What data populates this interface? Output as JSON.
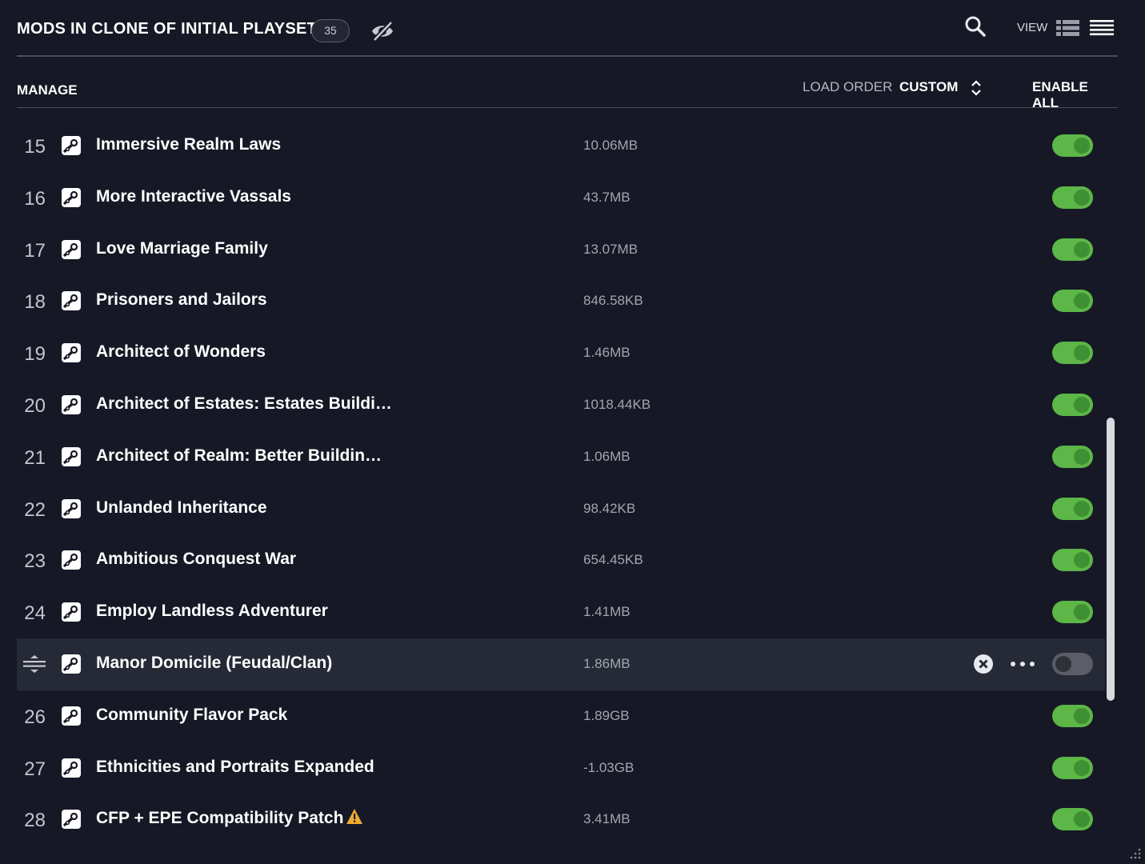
{
  "header": {
    "title": "MODS IN CLONE OF INITIAL PLAYSET",
    "count": "35",
    "view_label": "VIEW"
  },
  "subheader": {
    "manage": "MANAGE",
    "load_order_label": "LOAD ORDER",
    "load_order_value": "CUSTOM",
    "enable_all": "ENABLE ALL"
  },
  "mods": [
    {
      "index": "15",
      "name": "Immersive Realm Laws",
      "size": "10.06MB",
      "enabled": true
    },
    {
      "index": "16",
      "name": "More Interactive Vassals",
      "size": "43.7MB",
      "enabled": true
    },
    {
      "index": "17",
      "name": "Love Marriage Family",
      "size": "13.07MB",
      "enabled": true
    },
    {
      "index": "18",
      "name": "Prisoners and Jailors",
      "size": "846.58KB",
      "enabled": true
    },
    {
      "index": "19",
      "name": "Architect of Wonders",
      "size": "1.46MB",
      "enabled": true
    },
    {
      "index": "20",
      "name": "Architect of Estates: Estates Buildi…",
      "size": "1018.44KB",
      "enabled": true
    },
    {
      "index": "21",
      "name": "Architect of Realm: Better Buildin…",
      "size": "1.06MB",
      "enabled": true
    },
    {
      "index": "22",
      "name": "Unlanded Inheritance",
      "size": "98.42KB",
      "enabled": true
    },
    {
      "index": "23",
      "name": "Ambitious Conquest War",
      "size": "654.45KB",
      "enabled": true
    },
    {
      "index": "24",
      "name": "Employ Landless Adventurer",
      "size": "1.41MB",
      "enabled": true
    },
    {
      "index": "",
      "name": "Manor Domicile (Feudal/Clan)",
      "size": "1.86MB",
      "enabled": false,
      "selected": true
    },
    {
      "index": "26",
      "name": "Community Flavor Pack",
      "size": "1.89GB",
      "enabled": true
    },
    {
      "index": "27",
      "name": "Ethnicities and Portraits Expanded",
      "size": "-1.03GB",
      "enabled": true
    },
    {
      "index": "28",
      "name": "CFP + EPE Compatibility Patch",
      "size": "3.41MB",
      "enabled": true,
      "warning": true
    }
  ],
  "colors": {
    "background": "#161925",
    "toggle_on": "#5db648",
    "toggle_off": "#5b5e66",
    "warning": "#f0a830"
  },
  "icons": {
    "hidden": "eye-off-icon",
    "search": "search-icon",
    "grid_view": "grid-view-icon",
    "list_view": "list-view-icon",
    "sort": "sort-arrows-icon",
    "steam": "steam-icon",
    "drag": "drag-handle-icon",
    "remove": "remove-icon",
    "more": "more-options-icon",
    "warning": "warning-icon"
  }
}
